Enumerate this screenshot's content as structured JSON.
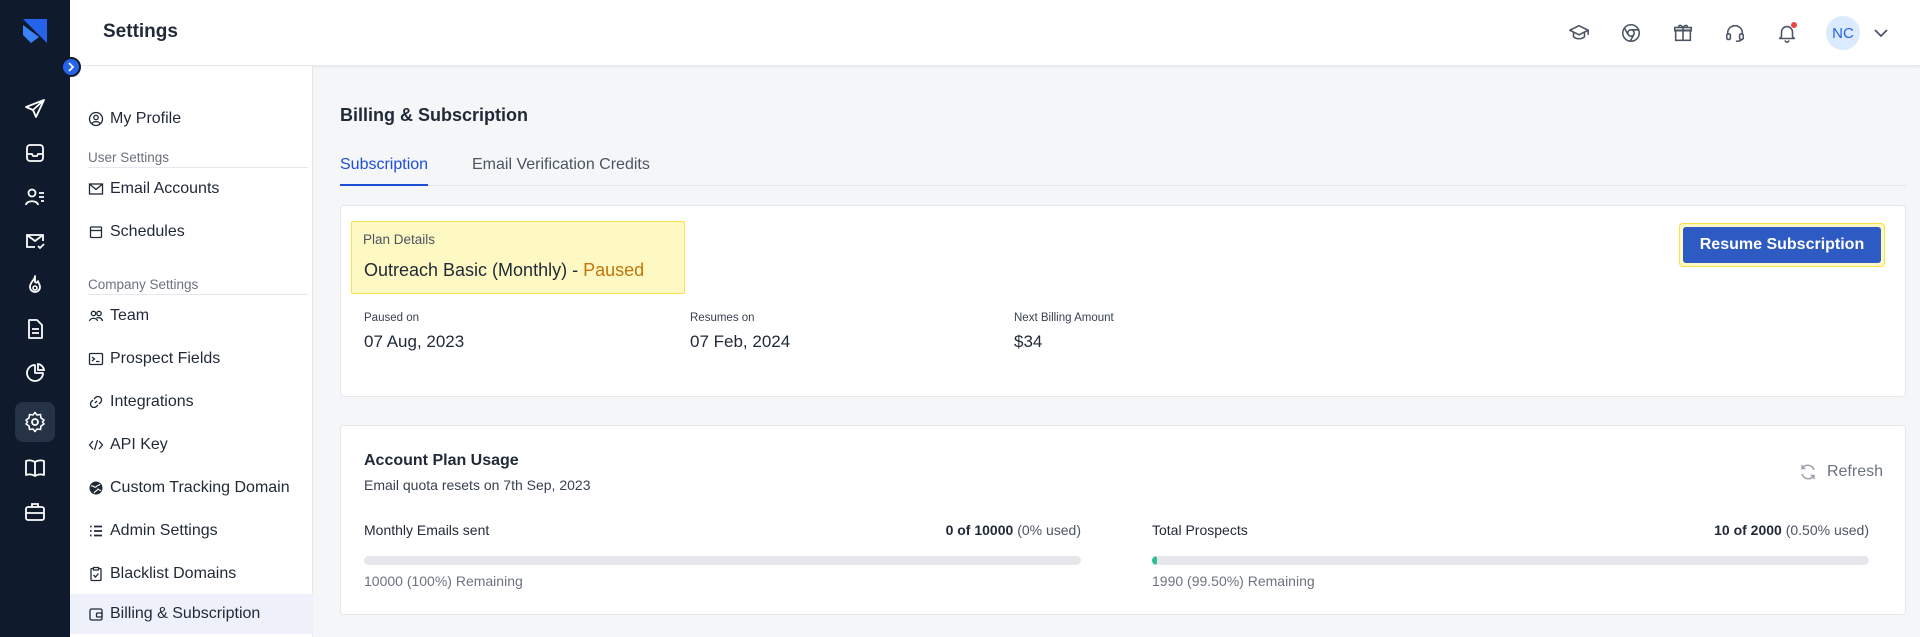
{
  "header": {
    "title": "Settings",
    "avatar_initials": "NC",
    "icons": [
      "graduation-cap-icon",
      "chrome-icon",
      "gift-icon",
      "headset-icon",
      "bell-icon"
    ]
  },
  "rail": {
    "icons": [
      "send-icon",
      "inbox-icon",
      "prospects-icon",
      "email-check-icon",
      "fire-icon",
      "document-icon",
      "pie-chart-icon",
      "gear-icon",
      "book-icon",
      "briefcase-icon"
    ],
    "active": "gear-icon"
  },
  "sidebar": {
    "my_profile": "My Profile",
    "user_settings_title": "User Settings",
    "email_accounts": "Email Accounts",
    "schedules": "Schedules",
    "company_settings_title": "Company Settings",
    "team": "Team",
    "prospect_fields": "Prospect Fields",
    "integrations": "Integrations",
    "api_key": "API Key",
    "custom_tracking_domain": "Custom Tracking Domain",
    "admin_settings": "Admin Settings",
    "blacklist_domains": "Blacklist Domains",
    "billing_subscription": "Billing & Subscription"
  },
  "main": {
    "title": "Billing & Subscription",
    "tabs": [
      {
        "label": "Subscription",
        "active": true
      },
      {
        "label": "Email Verification Credits",
        "active": false
      }
    ],
    "plan": {
      "label": "Plan Details",
      "name": "Outreach Basic (Monthly) - ",
      "status": "Paused",
      "resume_button": "Resume Subscription",
      "paused_on_label": "Paused on",
      "paused_on": "07 Aug, 2023",
      "resumes_on_label": "Resumes on",
      "resumes_on": "07 Feb, 2024",
      "next_billing_label": "Next Billing Amount",
      "next_billing": "$34"
    },
    "usage": {
      "title": "Account Plan Usage",
      "subtitle": "Email quota resets on 7th Sep, 2023",
      "refresh_label": "Refresh",
      "emails": {
        "label": "Monthly Emails sent",
        "count": "0 of 10000",
        "percent": "(0% used)",
        "remaining": "10000 (100%) Remaining",
        "used_fraction": 0
      },
      "prospects": {
        "label": "Total Prospects",
        "count": "10 of 2000",
        "percent": "(0.50% used)",
        "remaining": "1990 (99.50%) Remaining",
        "used_fraction": 0.005
      }
    }
  },
  "colors": {
    "rail_bg": "#0f1b2d",
    "accent": "#1d4ed8",
    "button": "#2d5bc3",
    "paused": "#c2750a",
    "highlight": "#fef9c3",
    "progress": "#2ebf91"
  }
}
